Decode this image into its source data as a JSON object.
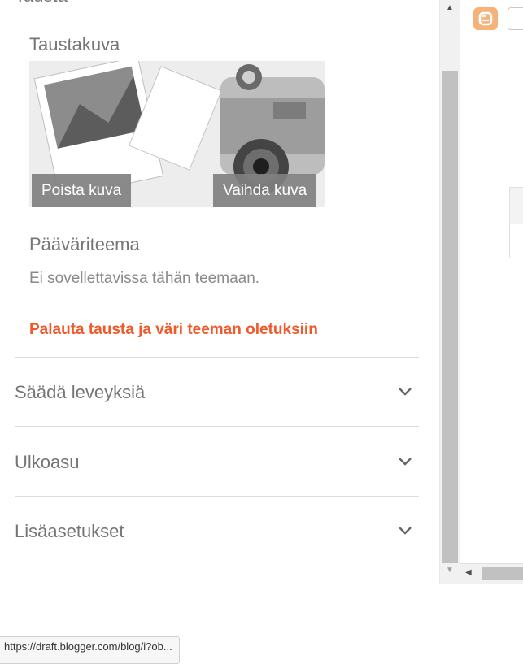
{
  "panel": {
    "header_cut": "Tausta",
    "background_image": {
      "title": "Taustakuva",
      "remove_label": "Poista kuva",
      "change_label": "Vaihda kuva"
    },
    "theme_color": {
      "title": "Pääväriteema",
      "note": "Ei sovellettavissa tähän teemaan."
    },
    "reset_link": "Palauta tausta ja väri teeman oletuksiin",
    "accordions": [
      {
        "label": "Säädä leveyksiä",
        "icon": "chevron-down-icon"
      },
      {
        "label": "Ulkoasu",
        "icon": "chevron-down-icon"
      },
      {
        "label": "Lisäasetukset",
        "icon": "chevron-down-icon"
      }
    ]
  },
  "right_pane": {
    "icon": "blogger-icon"
  },
  "statusbar": {
    "url": "https://draft.blogger.com/blog/i?ob..."
  },
  "colors": {
    "accent": "#f0592a",
    "text_muted": "#757575",
    "overlay": "#808080"
  }
}
